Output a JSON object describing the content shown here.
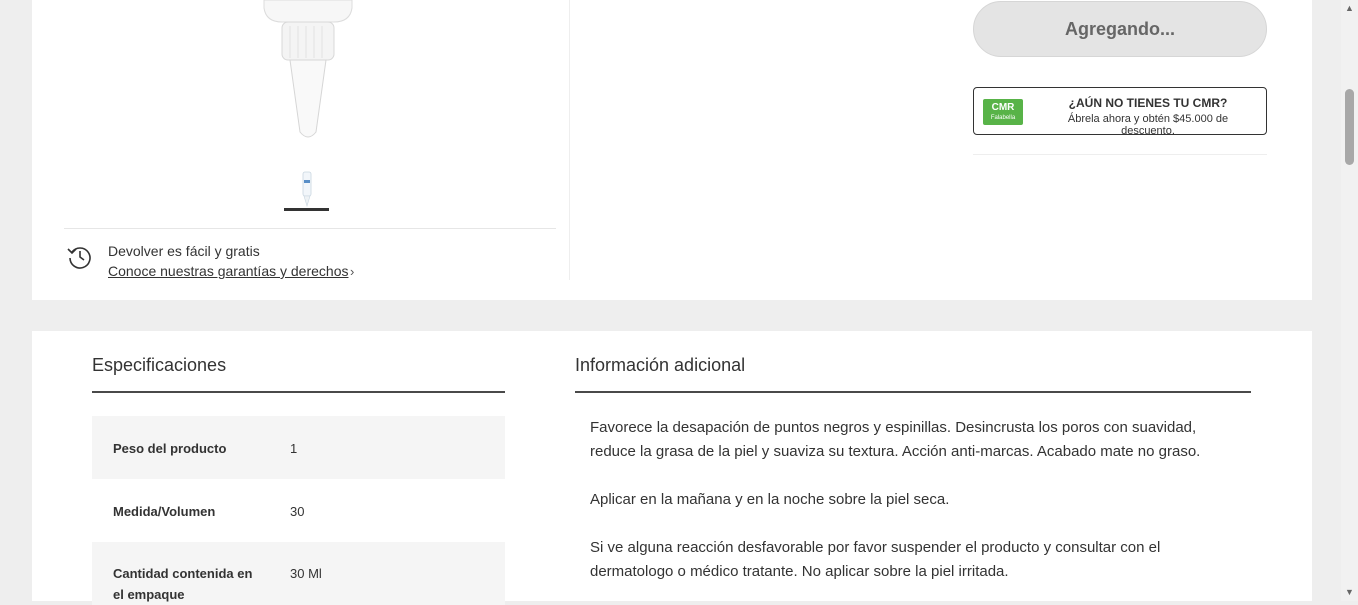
{
  "gallery": {
    "return_title": "Devolver es fácil y gratis",
    "return_link": "Conoce nuestras garantías y derechos",
    "return_chevron": "›"
  },
  "purchase": {
    "add_button_label": "Agregando...",
    "cmr_logo_line1": "CMR",
    "cmr_logo_line2": "Falabella",
    "cmr_title": "¿AÚN NO TIENES TU CMR?",
    "cmr_subtitle": "Ábrela ahora y obtén $45.000 de descuento."
  },
  "specifications": {
    "title": "Especificaciones",
    "rows": [
      {
        "label": "Peso del producto",
        "value": "1"
      },
      {
        "label": "Medida/Volumen",
        "value": "30"
      },
      {
        "label": "Cantidad contenida en el empaque",
        "value": "30 Ml"
      }
    ]
  },
  "additional_info": {
    "title": "Información adicional",
    "paragraphs": [
      "Favorece la desapación de puntos negros y espinillas. Desincrusta los poros con suavidad, reduce la grasa de la piel y suaviza su textura. Acción anti-marcas. Acabado mate no graso.",
      "Aplicar en la mañana y en la noche sobre la piel seca.",
      "Si ve alguna reacción desfavorable por favor suspender el producto y consultar con el dermatologo o médico tratante. No aplicar sobre la piel irritada."
    ]
  },
  "scrollbar": {
    "up_arrow": "▲",
    "down_arrow": "▼"
  }
}
